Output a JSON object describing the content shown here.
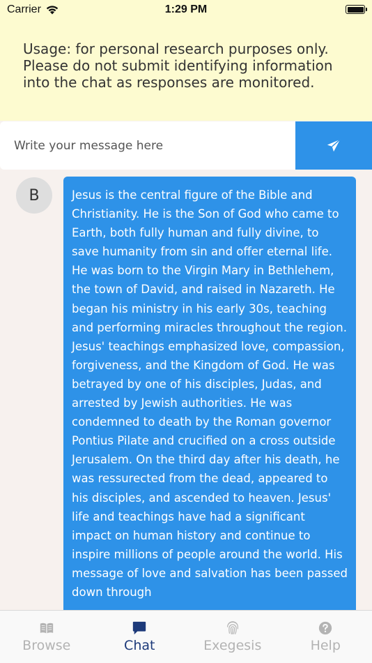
{
  "status_bar": {
    "carrier": "Carrier",
    "time": "1:29 PM"
  },
  "notice": {
    "text": "Usage: for personal research purposes only. Please do not submit identifying information into the chat as responses are monitored."
  },
  "composer": {
    "placeholder": "Write your message here",
    "send_icon": "paper-plane-icon"
  },
  "chat": {
    "messages": [
      {
        "avatar_letter": "B",
        "text": "Jesus is the central figure of the Bible and Christianity. He is the Son of God who came to Earth, both fully human and fully divine, to save humanity from sin and offer eternal life. He was born to the Virgin Mary in Bethlehem, the town of David, and raised in Nazareth. He began his ministry in his early 30s, teaching and performing miracles throughout the region. Jesus' teachings emphasized love, compassion, forgiveness, and the Kingdom of God. He was betrayed by one of his disciples, Judas, and arrested by Jewish authorities. He was condemned to death by the Roman governor Pontius Pilate and crucified on a cross outside Jerusalem. On the third day after his death, he was ressurected from the dead, appeared to his disciples, and ascended to heaven. Jesus' life and teachings have had a significant impact on human history and continue to inspire millions of people around the world. His message of love and salvation has been passed down through"
      }
    ]
  },
  "tabs": [
    {
      "label": "Browse",
      "icon": "book-icon",
      "active": false
    },
    {
      "label": "Chat",
      "icon": "chat-bubble-icon",
      "active": true
    },
    {
      "label": "Exegesis",
      "icon": "fingerprint-icon",
      "active": false
    },
    {
      "label": "Help",
      "icon": "question-circle-icon",
      "active": false
    }
  ],
  "colors": {
    "notice_bg": "#fdfbd0",
    "accent": "#2e92e8",
    "tab_active": "#1d3a7a",
    "tab_inactive": "#b3b3b3",
    "page_bg": "#f7f1ee"
  }
}
